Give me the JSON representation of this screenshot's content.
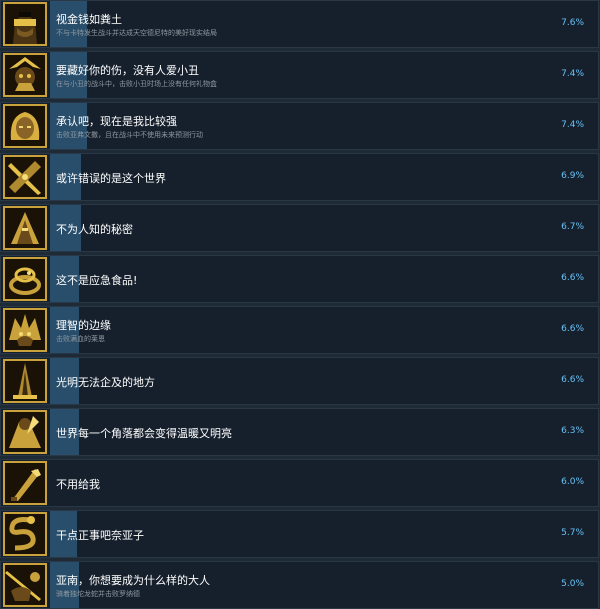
{
  "achievements": [
    {
      "title": "视金钱如粪土",
      "desc": "不与卡特发生战斗并达成天空德尼特的美好现实结局",
      "percent": "7.6%",
      "fill": 0.076,
      "icon": "blindfold-portrait-icon"
    },
    {
      "title": "要藏好你的伤，没有人爱小丑",
      "desc": "在与小丑的战斗中，击败小丑时场上没有任何礼物盒",
      "percent": "7.4%",
      "fill": 0.074,
      "icon": "jester-portrait-icon"
    },
    {
      "title": "承认吧，现在是我比较强",
      "desc": "击败亚弗文撒，且在战斗中不使用未来预测行动",
      "percent": "7.4%",
      "fill": 0.074,
      "icon": "blonde-portrait-icon"
    },
    {
      "title": "或许错误的是这个世界",
      "desc": "",
      "percent": "6.9%",
      "fill": 0.069,
      "icon": "broken-sword-icon"
    },
    {
      "title": "不为人知的秘密",
      "desc": "",
      "percent": "6.7%",
      "fill": 0.067,
      "icon": "hooded-figure-icon"
    },
    {
      "title": "这不是应急食品!",
      "desc": "",
      "percent": "6.6%",
      "fill": 0.066,
      "icon": "coiled-creature-icon"
    },
    {
      "title": "理智的边缘",
      "desc": "击败满血的莱恩",
      "percent": "6.6%",
      "fill": 0.066,
      "icon": "wild-beast-icon"
    },
    {
      "title": "光明无法企及的地方",
      "desc": "",
      "percent": "6.6%",
      "fill": 0.066,
      "icon": "dark-spire-icon"
    },
    {
      "title": "世界每一个角落都会变得温暖又明亮",
      "desc": "",
      "percent": "6.3%",
      "fill": 0.063,
      "icon": "cloaked-hero-icon"
    },
    {
      "title": "不用给我",
      "desc": "",
      "percent": "6.0%",
      "fill": 0.06,
      "icon": "bat-icon"
    },
    {
      "title": "干点正事吧奈亚子",
      "desc": "",
      "percent": "5.7%",
      "fill": 0.057,
      "icon": "serpent-icon"
    },
    {
      "title": "亚南，你想要成为什么样的大人",
      "desc": "骑着独坨龙蛇并击败罗纳德",
      "percent": "5.0%",
      "fill": 0.05,
      "icon": "lance-rider-icon"
    }
  ],
  "colors": {
    "row_bg": "#16202d",
    "bar": "#2b5777",
    "icon_border": "#c9a23c",
    "percent_text": "#67c1f5",
    "desc_text": "#8f98a0"
  }
}
